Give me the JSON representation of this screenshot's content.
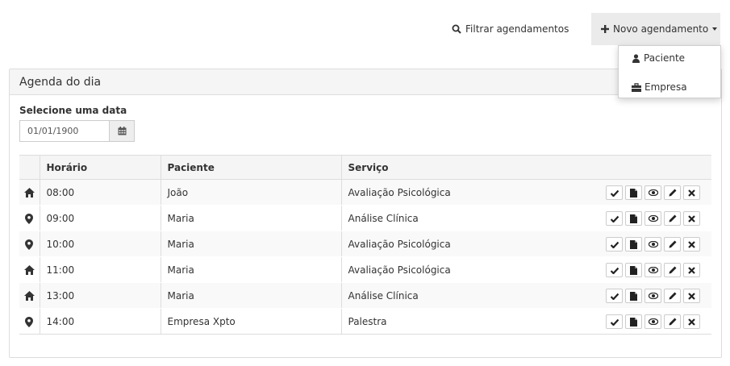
{
  "toolbar": {
    "filter_label": "Filtrar agendamentos",
    "new_label": "Novo agendamento",
    "new_menu": [
      {
        "label": "Paciente",
        "icon": "user-icon"
      },
      {
        "label": "Empresa",
        "icon": "briefcase-icon"
      }
    ]
  },
  "panel": {
    "title": "Agenda do dia",
    "date_label": "Selecione uma data",
    "date_value": "01/01/1900"
  },
  "table": {
    "headers": [
      "Horário",
      "Paciente",
      "Serviço"
    ],
    "rows": [
      {
        "icon": "home-icon",
        "time": "08:00",
        "patient": "João",
        "service": "Avaliação Psicológica"
      },
      {
        "icon": "map-marker-icon",
        "time": "09:00",
        "patient": "Maria",
        "service": "Análise Clínica"
      },
      {
        "icon": "map-marker-icon",
        "time": "10:00",
        "patient": "Maria",
        "service": "Avaliação Psicológica"
      },
      {
        "icon": "home-icon",
        "time": "11:00",
        "patient": "Maria",
        "service": "Avaliação Psicológica"
      },
      {
        "icon": "home-icon",
        "time": "13:00",
        "patient": "Maria",
        "service": "Análise Clínica"
      },
      {
        "icon": "map-marker-icon",
        "time": "14:00",
        "patient": "Empresa Xpto",
        "service": "Palestra"
      }
    ],
    "row_actions": [
      "confirm-icon",
      "document-icon",
      "view-icon",
      "edit-icon",
      "delete-icon"
    ]
  }
}
